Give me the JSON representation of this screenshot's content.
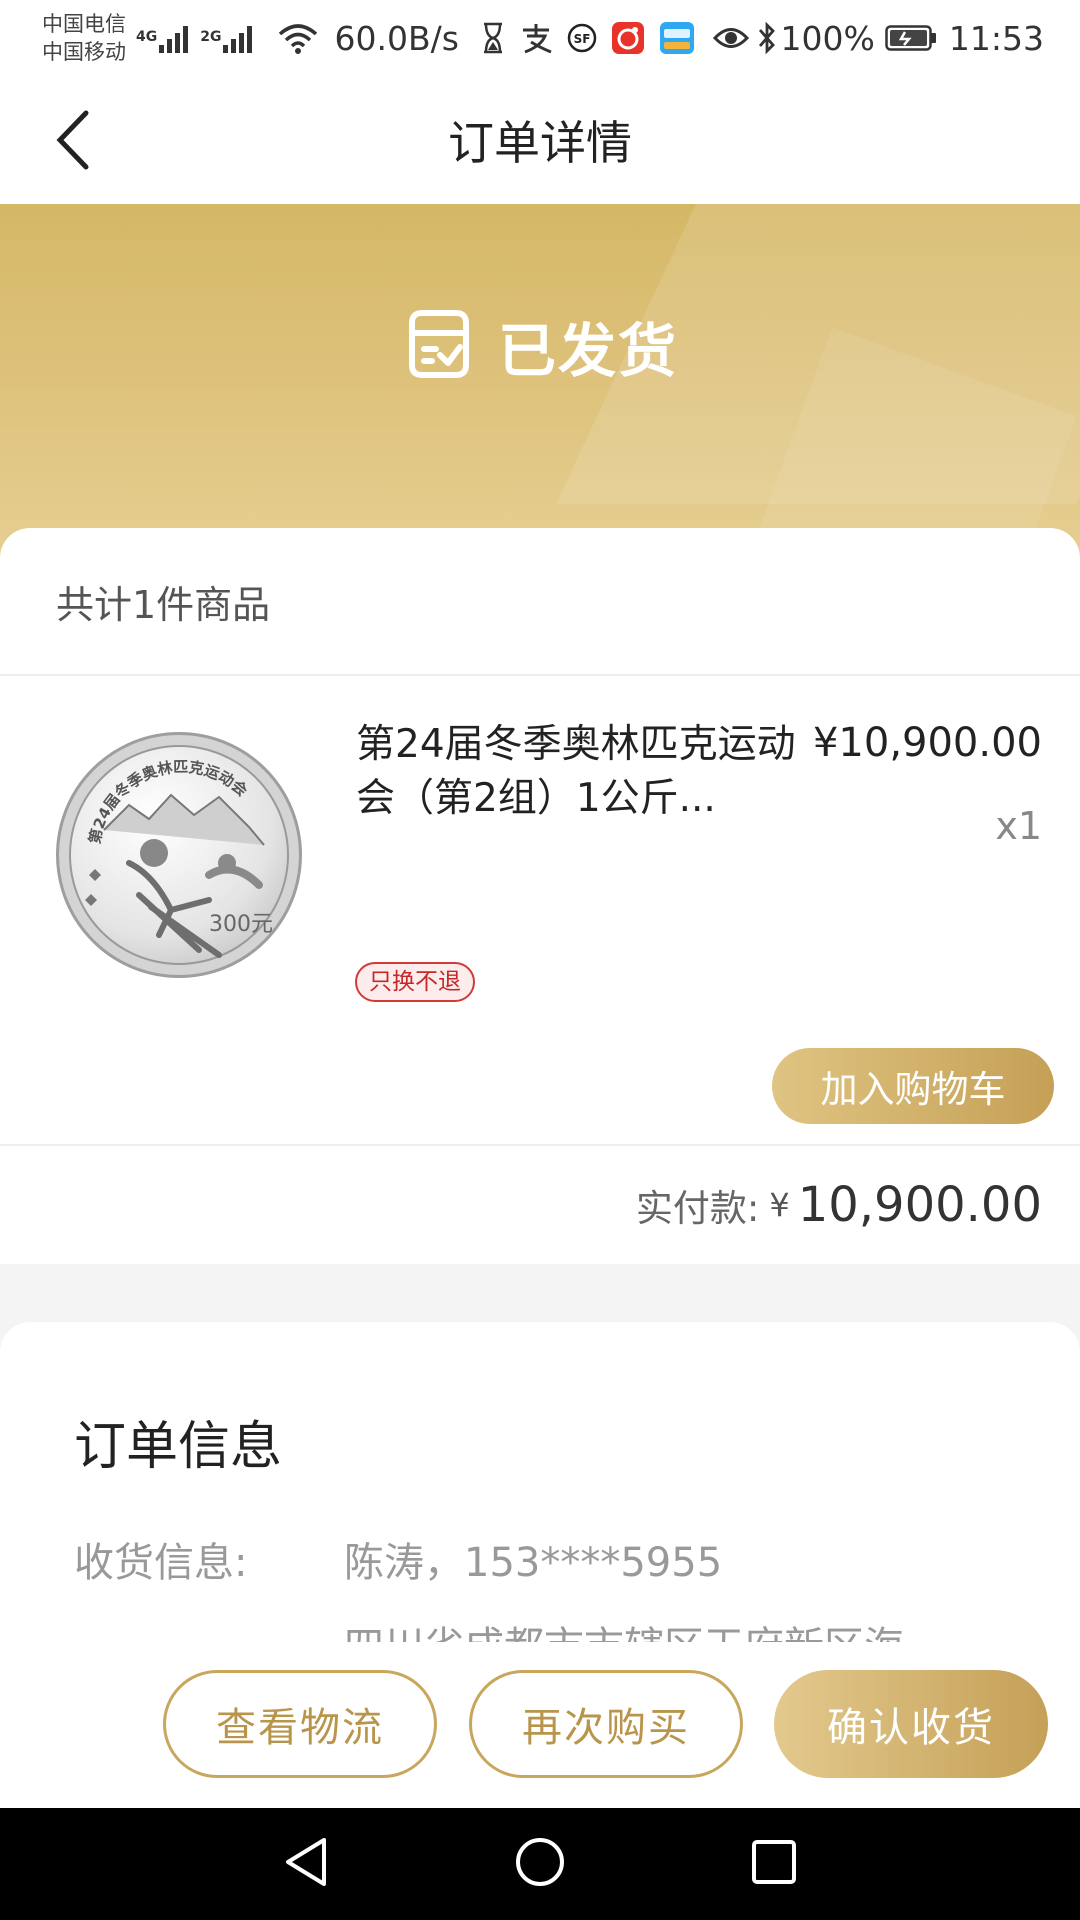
{
  "status_bar": {
    "carrier_1": "中国电信",
    "carrier_2": "中国移动",
    "net_1": "4G",
    "net_2": "2G",
    "speed": "60.0B/s",
    "battery": "100%",
    "time": "11:53",
    "icons": [
      "signal-icon",
      "wifi-icon",
      "hourglass-icon",
      "alipay-icon",
      "sf-express-icon",
      "app-red-icon",
      "app-blue-icon",
      "eye-icon",
      "bluetooth-icon",
      "battery-icon"
    ]
  },
  "header": {
    "title": "订单详情"
  },
  "banner": {
    "status": "已发货",
    "icon": "shipped-box-icon"
  },
  "order": {
    "count_text": "共计1件商品",
    "product": {
      "name": "第24届冬季奥林匹克运动会（第2组）1公斤...",
      "price": "¥10,900.00",
      "quantity": "x1",
      "tag": "只换不退",
      "coin_text": "第24届冬季奥林匹克运动会",
      "coin_value": "300元",
      "add_to_cart": "加入购物车"
    },
    "total_label": "实付款:",
    "total_currency": "¥",
    "total_amount": "10,900.00"
  },
  "order_info": {
    "title": "订单信息",
    "receiver_label": "收货信息:",
    "receiver_value": "陈涛，153****5955",
    "address_partial": "四川省成都市市辖区天府新区海"
  },
  "bottom_actions": {
    "logistics": "查看物流",
    "buy_again": "再次购买",
    "confirm": "确认收货"
  },
  "colors": {
    "gold": "#c8a75d",
    "banner": "#d9bc6f",
    "tag_red": "#c62828"
  }
}
